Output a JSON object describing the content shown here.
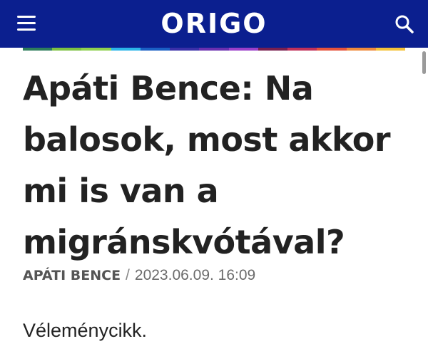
{
  "header": {
    "logo_text": "ORIGO",
    "menu_icon": "hamburger-menu-icon",
    "search_icon": "search-icon",
    "background_color": "#0b1f8f"
  },
  "color_strip": {
    "colors": [
      "#2e7d5b",
      "#7cc142",
      "#8fd14f",
      "#2bb5e8",
      "#1a5fc4",
      "#3a2fa8",
      "#6a2fb0",
      "#9b3fc9",
      "#7a1f4f",
      "#c0305a",
      "#e5533c",
      "#f08a3c",
      "#f5c23a"
    ]
  },
  "article": {
    "title": "Apáti Bence: Na balosok, most akkor mi is van a migránskvótával?",
    "author": "APÁTI BENCE",
    "separator": "/",
    "date": "2023.06.09. 16:09",
    "lead": "Véleménycikk."
  }
}
